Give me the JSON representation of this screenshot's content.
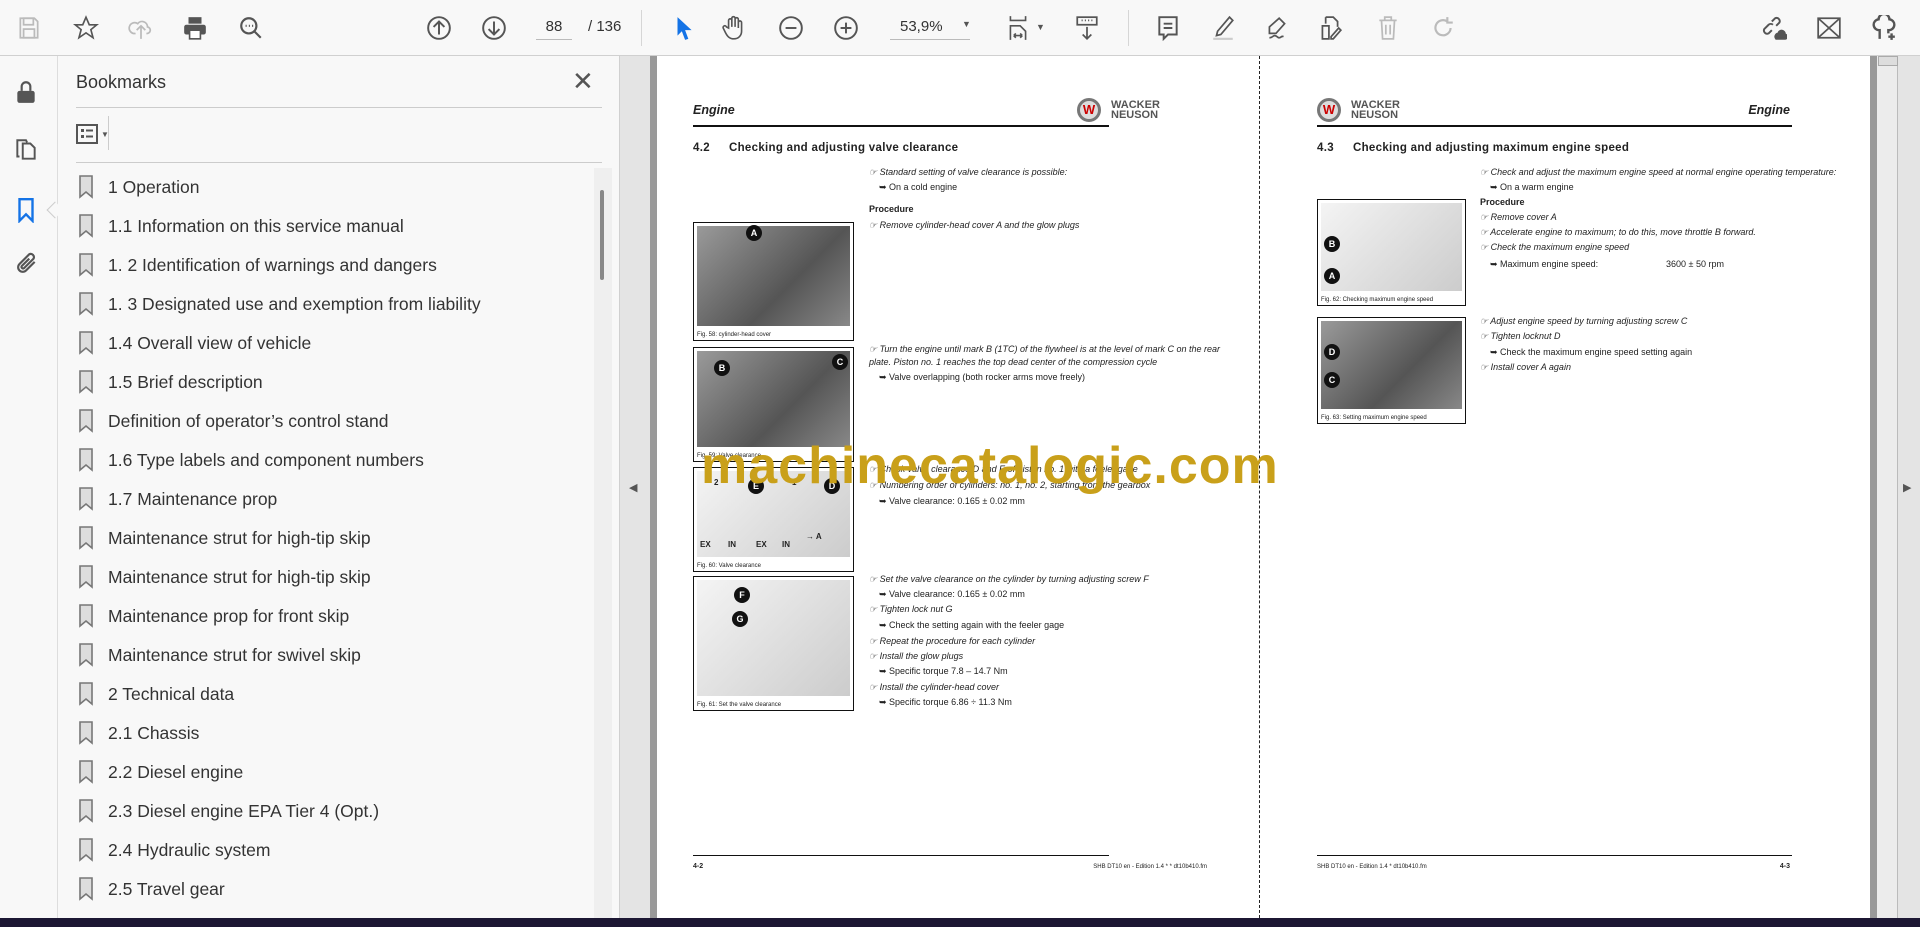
{
  "toolbar": {
    "icons": [
      "save-icon",
      "bookmark-star-icon",
      "upload-cloud-icon",
      "print-icon",
      "find-icon",
      "previous-page-icon",
      "next-page-icon",
      "select-tool-icon",
      "hand-tool-icon",
      "zoom-out-icon",
      "zoom-in-icon",
      "fit-page-icon",
      "scroll-mode-icon",
      "comment-icon",
      "highlight-icon",
      "sign-icon",
      "edit-pdf-icon",
      "delete-icon",
      "rotate-icon",
      "share-link-icon",
      "email-icon",
      "add-user-icon"
    ],
    "current_page": "88",
    "total_pages": "/ 136",
    "zoom": "53,9%",
    "accent": "#1473e6"
  },
  "sidebar": {
    "rail_icons": [
      "lock-icon",
      "pages-icon",
      "bookmarks-icon",
      "attachments-icon"
    ],
    "title": "Bookmarks",
    "items": [
      {
        "label": "1 Operation"
      },
      {
        "label": "1.1 Information on this service manual"
      },
      {
        "label": "1. 2 Identification of warnings and dangers"
      },
      {
        "label": "1. 3 Designated use and exemption from liability"
      },
      {
        "label": "1.4 Overall view of vehicle"
      },
      {
        "label": "1.5 Brief description"
      },
      {
        "label": "Definition of operator’s control stand"
      },
      {
        "label": "1.6 Type labels and component numbers"
      },
      {
        "label": "1.7 Maintenance prop"
      },
      {
        "label": "Maintenance strut for high-tip skip"
      },
      {
        "label": "Maintenance strut for high-tip skip"
      },
      {
        "label": "Maintenance prop for front skip"
      },
      {
        "label": "Maintenance strut for swivel skip"
      },
      {
        "label": "2 Technical data"
      },
      {
        "label": "2.1 Chassis"
      },
      {
        "label": "2.2 Diesel engine"
      },
      {
        "label": "2.3 Diesel engine EPA Tier 4 (Opt.)"
      },
      {
        "label": "2.4 Hydraulic system"
      },
      {
        "label": "2.5 Travel gear"
      }
    ]
  },
  "document": {
    "watermark": "machinecatalogic.com",
    "logo_text": "WACKER NEUSON",
    "left_page": {
      "header": "Engine",
      "section_number": "4.2",
      "section_title": "Checking and adjusting valve clearance",
      "lines": [
        {
          "text": "☞ Standard setting of valve clearance is possible:",
          "kind": "step"
        },
        {
          "text": "➥ On a cold engine",
          "kind": "sub"
        },
        {
          "text": "Procedure",
          "kind": "bold"
        },
        {
          "text": "☞ Remove cylinder-head cover A and the glow plugs",
          "kind": "step"
        },
        {
          "text": "☞ Turn the engine until mark B (1TC) of the flywheel is at the level of mark C on the rear",
          "kind": "step"
        },
        {
          "text": "plate. Piston no. 1 reaches the top dead center of the compression cycle",
          "kind": "step"
        },
        {
          "text": "➥ Valve overlapping (both rocker arms move freely)",
          "kind": "sub"
        },
        {
          "text": "☞ Check valve clearance D and E of piston no. 1 with a feeler gage",
          "kind": "step"
        },
        {
          "text": "☞ Numbering order of cylinders: no. 1, no. 2, starting from the gearbox",
          "kind": "step"
        },
        {
          "text": "➥ Valve clearance: 0.165 ± 0.02 mm",
          "kind": "sub"
        },
        {
          "text": "☞ Set the valve clearance on the cylinder by turning adjusting screw F",
          "kind": "step"
        },
        {
          "text": "➥ Valve clearance: 0.165 ± 0.02 mm",
          "kind": "sub"
        },
        {
          "text": "☞ Tighten lock nut G",
          "kind": "step"
        },
        {
          "text": "➥ Check the setting again with the feeler gage",
          "kind": "sub"
        },
        {
          "text": "☞ Repeat the procedure for each cylinder",
          "kind": "step"
        },
        {
          "text": "☞ Install the glow plugs",
          "kind": "step"
        },
        {
          "text": "➥ Specific torque 7.8 – 14.7 Nm",
          "kind": "sub"
        },
        {
          "text": "☞ Install the cylinder-head cover",
          "kind": "step"
        },
        {
          "text": "➥ Specific torque 6.86 ÷ 11.3 Nm",
          "kind": "sub"
        }
      ],
      "figures": [
        {
          "caption": "Fig. 58:   cylinder-head cover",
          "callouts": [
            "A"
          ]
        },
        {
          "caption": "Fig. 59:   Valve clearance",
          "callouts": [
            "B",
            "C"
          ]
        },
        {
          "caption": "Fig. 60:   Valve clearance",
          "callouts": [
            "E",
            "D"
          ],
          "labels": [
            "2",
            "1",
            "EX",
            "IN",
            "EX",
            "IN",
            "→ A"
          ]
        },
        {
          "caption": "Fig. 61:   Set the valve clearance",
          "callouts": [
            "F",
            "G"
          ]
        }
      ],
      "footer_page": "4-2",
      "footer_text": "SHB DT10 en - Edition 1.4 * * dt10b410.fm"
    },
    "right_page": {
      "header": "Engine",
      "section_number": "4.3",
      "section_title": "Checking and adjusting maximum engine speed",
      "lines": [
        {
          "text": "☞ Check and adjust the maximum engine speed at normal engine operating temperature:",
          "kind": "step"
        },
        {
          "text": "➥ On a warm engine",
          "kind": "sub"
        },
        {
          "text": "Procedure",
          "kind": "bold"
        },
        {
          "text": "☞ Remove cover A",
          "kind": "step"
        },
        {
          "text": "☞ Accelerate engine to maximum; to do this, move throttle B forward.",
          "kind": "step"
        },
        {
          "text": "☞ Check the maximum engine speed",
          "kind": "step"
        },
        {
          "text": "➥ Maximum engine speed:",
          "kind": "sub"
        },
        {
          "text": "☞ Adjust engine speed by turning adjusting screw C",
          "kind": "step"
        },
        {
          "text": "☞ Tighten locknut D",
          "kind": "step"
        },
        {
          "text": "➥ Check the maximum engine speed setting again",
          "kind": "sub"
        },
        {
          "text": "☞ Install cover A again",
          "kind": "step"
        }
      ],
      "max_speed_value": "3600 ± 50 rpm",
      "figures": [
        {
          "caption": "Fig. 62:   Checking maximum engine speed",
          "callouts": [
            "B",
            "A"
          ]
        },
        {
          "caption": "Fig. 63:   Setting maximum engine speed",
          "callouts": [
            "D",
            "C"
          ]
        }
      ],
      "footer_page": "4-3",
      "footer_text": "SHB DT10 en - Edition 1.4 * dt10b410.fm"
    }
  }
}
